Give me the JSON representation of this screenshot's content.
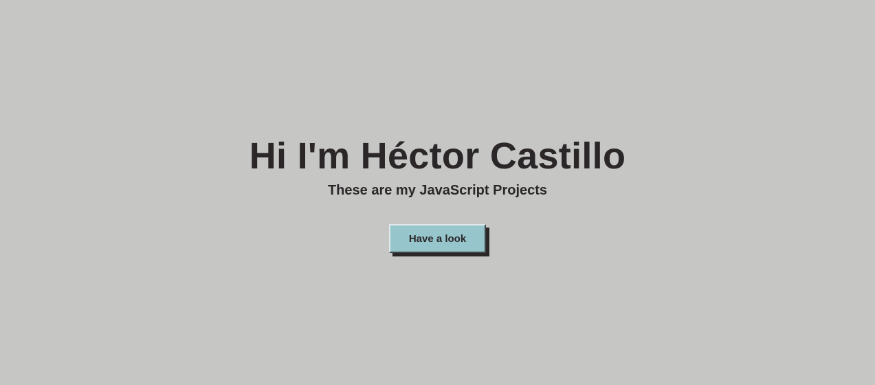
{
  "hero": {
    "title": "Hi I'm Héctor Castillo",
    "subtitle": "These are my JavaScript Projects",
    "button_label": "Have a look"
  },
  "colors": {
    "background": "#c6c6c5",
    "button": "#96c5cc",
    "text": "#2b2728"
  }
}
